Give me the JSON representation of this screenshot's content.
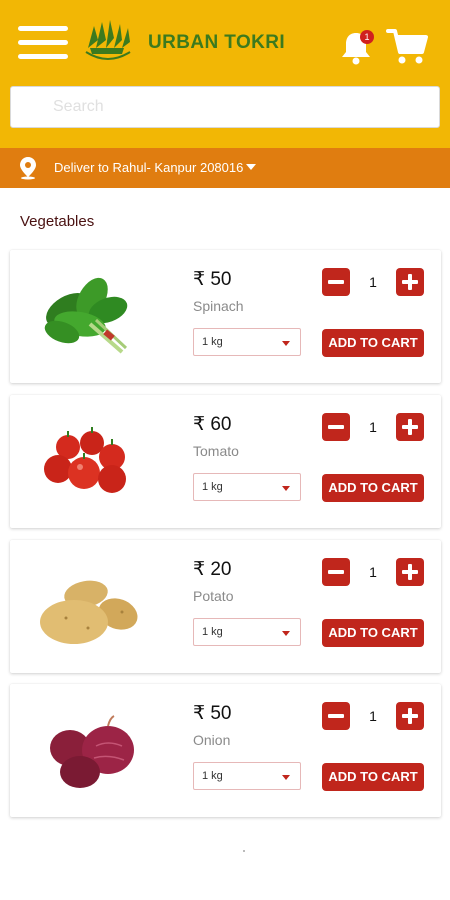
{
  "header": {
    "brand": "URBAN TOKRI",
    "notification_count": "1",
    "colors": {
      "header_bg": "#f2b705",
      "brand_green": "#3c7a1e",
      "deliver_bg": "#e07d10",
      "accent_red": "#c0261c"
    }
  },
  "search": {
    "placeholder": "Search"
  },
  "deliver": {
    "text": "Deliver to Rahul- Kanpur 208016"
  },
  "section": {
    "title": "Vegetables"
  },
  "products": [
    {
      "price": "₹ 50",
      "name": "Spinach",
      "unit": "1 kg",
      "qty": "1",
      "add_label": "ADD TO CART",
      "image": "spinach-image"
    },
    {
      "price": "₹ 60",
      "name": "Tomato",
      "unit": "1 kg",
      "qty": "1",
      "add_label": "ADD TO CART",
      "image": "tomato-image"
    },
    {
      "price": "₹ 20",
      "name": "Potato",
      "unit": "1 kg",
      "qty": "1",
      "add_label": "ADD TO CART",
      "image": "potato-image"
    },
    {
      "price": "₹ 50",
      "name": "Onion",
      "unit": "1 kg",
      "qty": "1",
      "add_label": "ADD TO CART",
      "image": "onion-image"
    }
  ]
}
